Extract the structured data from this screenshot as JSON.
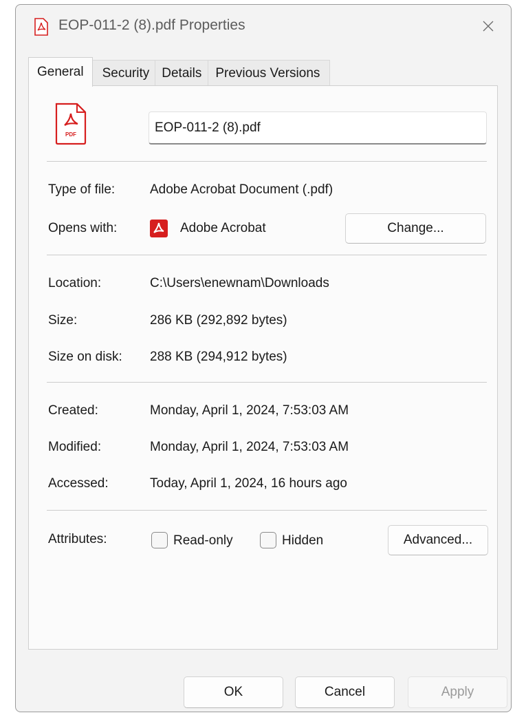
{
  "window": {
    "title": "EOP-011-2 (8).pdf Properties"
  },
  "tabs": [
    {
      "label": "General",
      "active": true
    },
    {
      "label": "Security",
      "active": false
    },
    {
      "label": "Details",
      "active": false
    },
    {
      "label": "Previous Versions",
      "active": false
    }
  ],
  "general": {
    "file_name": "EOP-011-2 (8).pdf",
    "file_icon_text": "PDF",
    "type_label": "Type of file:",
    "type_value": "Adobe Acrobat Document (.pdf)",
    "opens_label": "Opens with:",
    "opens_value": "Adobe Acrobat",
    "change_button": "Change...",
    "location_label": "Location:",
    "location_value": "C:\\Users\\enewnam\\Downloads",
    "size_label": "Size:",
    "size_value": "286 KB (292,892 bytes)",
    "size_on_disk_label": "Size on disk:",
    "size_on_disk_value": "288 KB (294,912 bytes)",
    "created_label": "Created:",
    "created_value": "Monday, April 1, 2024, 7:53:03 AM",
    "modified_label": "Modified:",
    "modified_value": "Monday, April 1, 2024, 7:53:03 AM",
    "accessed_label": "Accessed:",
    "accessed_value": "Today, April 1, 2024, 16 hours ago",
    "attributes_label": "Attributes:",
    "readonly_label": "Read-only",
    "readonly_checked": false,
    "hidden_label": "Hidden",
    "hidden_checked": false,
    "advanced_button": "Advanced..."
  },
  "footer": {
    "ok_label": "OK",
    "cancel_label": "Cancel",
    "apply_label": "Apply",
    "apply_enabled": false
  },
  "colors": {
    "accent_pdf_red": "#d61e1e",
    "disabled_text": "#9a9a9a"
  },
  "icons": {
    "title_icon": "pdf-file-icon",
    "close_icon": "close-icon",
    "file_icon": "pdf-document-icon",
    "app_icon": "adobe-acrobat-icon"
  }
}
